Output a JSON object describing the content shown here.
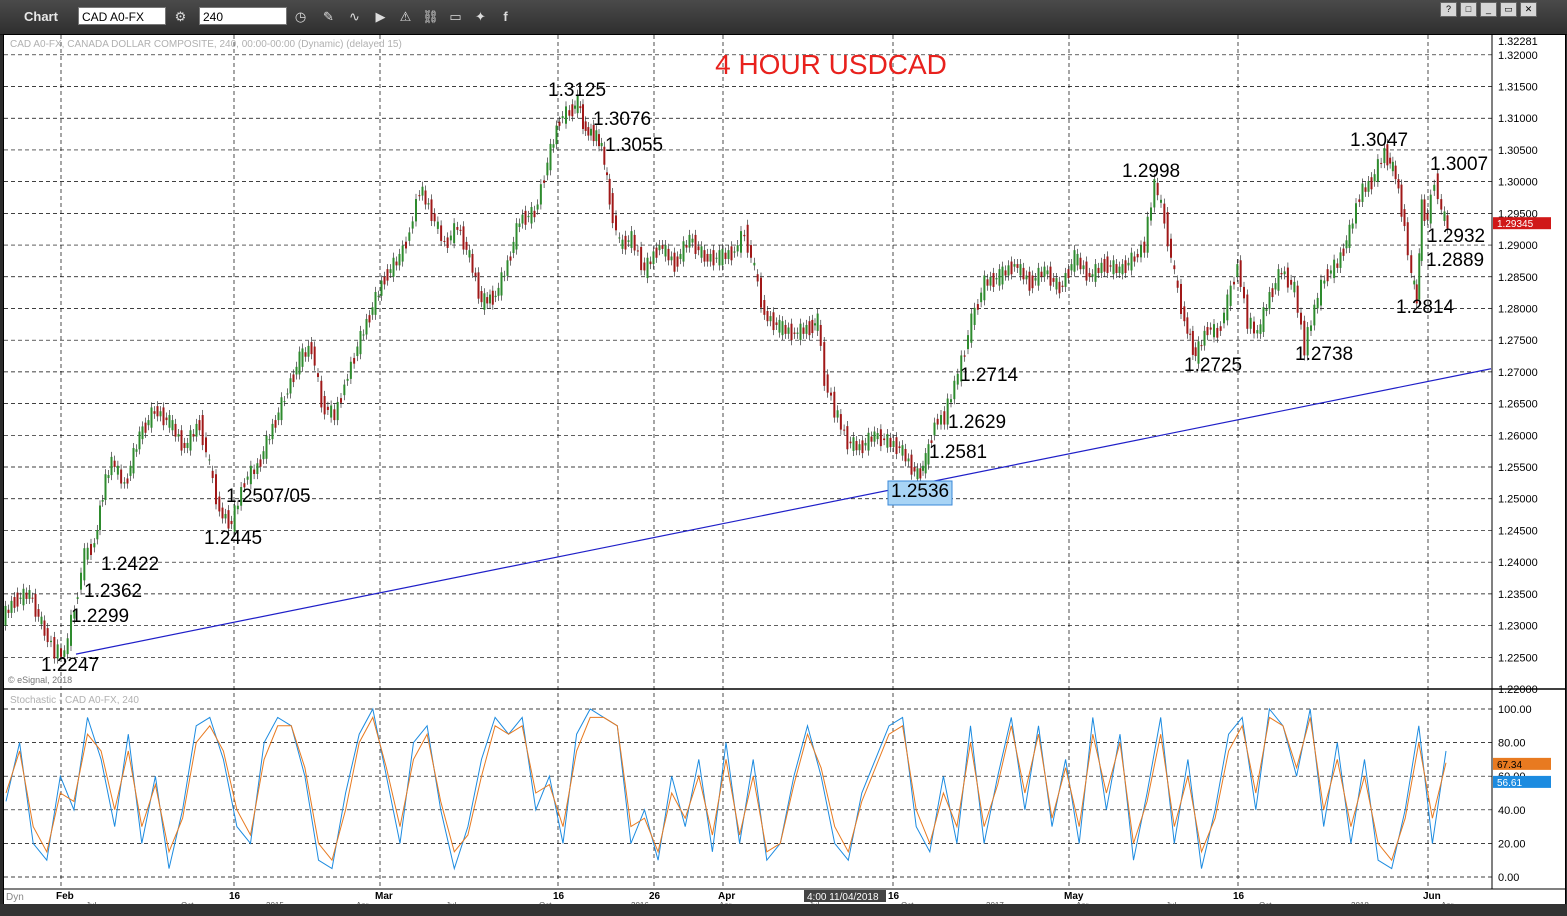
{
  "app": {
    "title": "Chart",
    "symbol": "CAD A0-FX",
    "interval": "240"
  },
  "toolbar_icons": [
    "settings-icon",
    "clock-icon",
    "pencil-icon",
    "line-study-icon",
    "play-icon",
    "alert-icon",
    "link-icon",
    "comment-icon",
    "twitter-icon",
    "facebook-icon"
  ],
  "window_buttons": [
    "?",
    "□",
    "_",
    "▭",
    "✕"
  ],
  "chart_info": "CAD A0-FX, CANADA DOLLAR COMPOSITE, 240, 00:00-00:00 (Dynamic) (delayed 15)",
  "copyright": "© eSignal, 2018",
  "stoch_info": "Stochastic - CAD A0-FX, 240",
  "crosshair_time": "4:00 11/04/2018",
  "dyn_label": "Dyn",
  "current_price": "1.29345",
  "top_price": "1.32281",
  "stoch_values": [
    "67.34",
    "56.61"
  ],
  "chart_data": {
    "type": "line",
    "title": "4 HOUR USDCAD",
    "ylim": [
      1.22,
      1.32281
    ],
    "y_ticks": [
      "1.32000",
      "1.31500",
      "1.31000",
      "1.30500",
      "1.30000",
      "1.29500",
      "1.29000",
      "1.28500",
      "1.28000",
      "1.27500",
      "1.27000",
      "1.26500",
      "1.26000",
      "1.25500",
      "1.25000",
      "1.24500",
      "1.24000",
      "1.23500",
      "1.23000",
      "1.22500",
      "1.22000"
    ],
    "x_ticks_top": [
      "Feb",
      "16",
      "Mar",
      "16",
      "26",
      "Apr",
      "16",
      "May",
      "16",
      "Jun"
    ],
    "x_ticks_bottom": [
      "Jul",
      "Oct",
      "2015",
      "Apr",
      "Jul",
      "Oct",
      "2016",
      "Apr",
      "Jul",
      "Oct",
      "2017",
      "Apr",
      "Jul",
      "Oct",
      "2018",
      "Apr"
    ],
    "series": [
      {
        "values": [
          [
            0,
            1.2305
          ],
          [
            15,
            1.234
          ],
          [
            30,
            1.235
          ],
          [
            45,
            1.229
          ],
          [
            55,
            1.226
          ],
          [
            65,
            1.2255
          ],
          [
            75,
            1.233
          ],
          [
            85,
            1.241
          ],
          [
            95,
            1.243
          ],
          [
            103,
            1.251
          ],
          [
            112,
            1.256
          ],
          [
            125,
            1.252
          ],
          [
            140,
            1.26
          ],
          [
            155,
            1.264
          ],
          [
            170,
            1.262
          ],
          [
            185,
            1.258
          ],
          [
            200,
            1.262
          ],
          [
            210,
            1.255
          ],
          [
            220,
            1.248
          ],
          [
            232,
            1.246
          ],
          [
            245,
            1.253
          ],
          [
            258,
            1.255
          ],
          [
            270,
            1.26
          ],
          [
            285,
            1.266
          ],
          [
            300,
            1.272
          ],
          [
            312,
            1.274
          ],
          [
            322,
            1.265
          ],
          [
            335,
            1.263
          ],
          [
            345,
            1.268
          ],
          [
            358,
            1.274
          ],
          [
            370,
            1.279
          ],
          [
            385,
            1.285
          ],
          [
            400,
            1.288
          ],
          [
            410,
            1.292
          ],
          [
            420,
            1.299
          ],
          [
            432,
            1.295
          ],
          [
            445,
            1.29
          ],
          [
            458,
            1.293
          ],
          [
            470,
            1.288
          ],
          [
            482,
            1.281
          ],
          [
            496,
            1.282
          ],
          [
            508,
            1.287
          ],
          [
            520,
            1.294
          ],
          [
            535,
            1.295
          ],
          [
            548,
            1.303
          ],
          [
            560,
            1.31
          ],
          [
            570,
            1.311
          ],
          [
            578,
            1.3125
          ],
          [
            586,
            1.308
          ],
          [
            594,
            1.3076
          ],
          [
            602,
            1.3055
          ],
          [
            610,
            1.297
          ],
          [
            620,
            1.29
          ],
          [
            632,
            1.291
          ],
          [
            645,
            1.286
          ],
          [
            660,
            1.29
          ],
          [
            675,
            1.287
          ],
          [
            690,
            1.291
          ],
          [
            705,
            1.288
          ],
          [
            720,
            1.288
          ],
          [
            735,
            1.289
          ],
          [
            745,
            1.292
          ],
          [
            755,
            1.286
          ],
          [
            765,
            1.279
          ],
          [
            780,
            1.277
          ],
          [
            795,
            1.276
          ],
          [
            810,
            1.277
          ],
          [
            818,
            1.278
          ],
          [
            825,
            1.269
          ],
          [
            835,
            1.264
          ],
          [
            848,
            1.259
          ],
          [
            860,
            1.258
          ],
          [
            875,
            1.26
          ],
          [
            888,
            1.259
          ],
          [
            900,
            1.258
          ],
          [
            912,
            1.255
          ],
          [
            918,
            1.2536
          ],
          [
            926,
            1.256
          ],
          [
            935,
            1.262
          ],
          [
            945,
            1.2629
          ],
          [
            955,
            1.268
          ],
          [
            962,
            1.2714
          ],
          [
            972,
            1.278
          ],
          [
            985,
            1.284
          ],
          [
            1000,
            1.285
          ],
          [
            1015,
            1.287
          ],
          [
            1030,
            1.284
          ],
          [
            1045,
            1.286
          ],
          [
            1060,
            1.283
          ],
          [
            1075,
            1.288
          ],
          [
            1090,
            1.285
          ],
          [
            1105,
            1.287
          ],
          [
            1120,
            1.286
          ],
          [
            1135,
            1.288
          ],
          [
            1145,
            1.29
          ],
          [
            1155,
            1.2998
          ],
          [
            1165,
            1.294
          ],
          [
            1175,
            1.285
          ],
          [
            1185,
            1.278
          ],
          [
            1196,
            1.2725
          ],
          [
            1208,
            1.277
          ],
          [
            1218,
            1.276
          ],
          [
            1228,
            1.281
          ],
          [
            1238,
            1.287
          ],
          [
            1248,
            1.278
          ],
          [
            1258,
            1.276
          ],
          [
            1270,
            1.282
          ],
          [
            1282,
            1.286
          ],
          [
            1295,
            1.283
          ],
          [
            1305,
            1.2738
          ],
          [
            1315,
            1.28
          ],
          [
            1325,
            1.285
          ],
          [
            1338,
            1.287
          ],
          [
            1350,
            1.292
          ],
          [
            1360,
            1.298
          ],
          [
            1372,
            1.3
          ],
          [
            1385,
            1.3047
          ],
          [
            1396,
            1.301
          ],
          [
            1405,
            1.293
          ],
          [
            1412,
            1.285
          ],
          [
            1417,
            1.2814
          ],
          [
            1422,
            1.296
          ],
          [
            1428,
            1.294
          ],
          [
            1435,
            1.3007
          ],
          [
            1442,
            1.295
          ],
          [
            1448,
            1.2932
          ]
        ]
      }
    ],
    "trendline": [
      [
        75,
        1.2255
      ],
      [
        1490,
        1.2705
      ]
    ],
    "annotations": [
      {
        "label": "1.2247",
        "x": 70,
        "y": 1.2247
      },
      {
        "label": "1.2299",
        "x": 100,
        "y": 1.2299
      },
      {
        "label": "1.2362",
        "x": 112,
        "y": 1.2362
      },
      {
        "label": "1.2422",
        "x": 130,
        "y": 1.2422
      },
      {
        "label": "1.2445",
        "x": 232,
        "y": 1.2445
      },
      {
        "label": "1.2507/05",
        "x": 270,
        "y": 1.2507
      },
      {
        "label": "1.3125",
        "x": 576,
        "y": 1.3125
      },
      {
        "label": "1.3076",
        "x": 622,
        "y": 1.3076
      },
      {
        "label": "1.3055",
        "x": 632,
        "y": 1.3055
      },
      {
        "label": "1.2536",
        "x": 918,
        "y": 1.2536,
        "boxed": true
      },
      {
        "label": "1.2581",
        "x": 955,
        "y": 1.2581
      },
      {
        "label": "1.2629",
        "x": 975,
        "y": 1.2629
      },
      {
        "label": "1.2714",
        "x": 987,
        "y": 1.2714
      },
      {
        "label": "1.2998",
        "x": 1149,
        "y": 1.2998
      },
      {
        "label": "1.2725",
        "x": 1211,
        "y": 1.2725
      },
      {
        "label": "1.2738",
        "x": 1322,
        "y": 1.2738
      },
      {
        "label": "1.3047",
        "x": 1377,
        "y": 1.3047
      },
      {
        "label": "1.3007",
        "x": 1458,
        "y": 1.3007
      },
      {
        "label": "1.2932",
        "x": 1454,
        "y": 1.2932
      },
      {
        "label": "1.2889",
        "x": 1453,
        "y": 1.2889
      },
      {
        "label": "1.2814",
        "x": 1423,
        "y": 1.2814
      }
    ],
    "stochastic": {
      "ylim": [
        0,
        100
      ],
      "y_ticks": [
        "100.00",
        "80.00",
        "60.00",
        "40.00",
        "20.00",
        "0.00"
      ],
      "k": [
        45,
        80,
        20,
        10,
        60,
        40,
        95,
        70,
        30,
        85,
        20,
        60,
        5,
        40,
        90,
        95,
        70,
        30,
        20,
        80,
        95,
        90,
        60,
        10,
        5,
        50,
        85,
        100,
        60,
        20,
        80,
        90,
        40,
        5,
        30,
        70,
        95,
        85,
        95,
        40,
        60,
        20,
        85,
        100,
        95,
        90,
        20,
        40,
        10,
        60,
        30,
        70,
        15,
        80,
        20,
        70,
        10,
        20,
        60,
        90,
        60,
        20,
        10,
        50,
        70,
        90,
        95,
        30,
        15,
        60,
        20,
        90,
        20,
        60,
        95,
        40,
        90,
        30,
        70,
        20,
        95,
        40,
        85,
        10,
        50,
        95,
        20,
        70,
        5,
        40,
        85,
        95,
        40,
        100,
        90,
        60,
        100,
        30,
        80,
        20,
        70,
        10,
        5,
        40,
        90,
        20,
        75
      ],
      "d": [
        50,
        75,
        30,
        15,
        50,
        45,
        85,
        75,
        40,
        75,
        30,
        55,
        15,
        35,
        80,
        90,
        75,
        40,
        25,
        70,
        90,
        90,
        65,
        20,
        10,
        40,
        80,
        95,
        65,
        30,
        70,
        85,
        45,
        15,
        25,
        60,
        90,
        85,
        90,
        50,
        55,
        30,
        75,
        95,
        95,
        90,
        30,
        35,
        15,
        50,
        35,
        60,
        25,
        70,
        25,
        60,
        15,
        20,
        55,
        85,
        65,
        30,
        15,
        45,
        65,
        85,
        90,
        40,
        20,
        50,
        30,
        80,
        30,
        55,
        90,
        50,
        85,
        35,
        65,
        30,
        85,
        50,
        80,
        20,
        45,
        85,
        30,
        60,
        15,
        35,
        75,
        90,
        50,
        95,
        90,
        65,
        95,
        40,
        70,
        30,
        60,
        20,
        10,
        35,
        80,
        35,
        68
      ]
    }
  }
}
